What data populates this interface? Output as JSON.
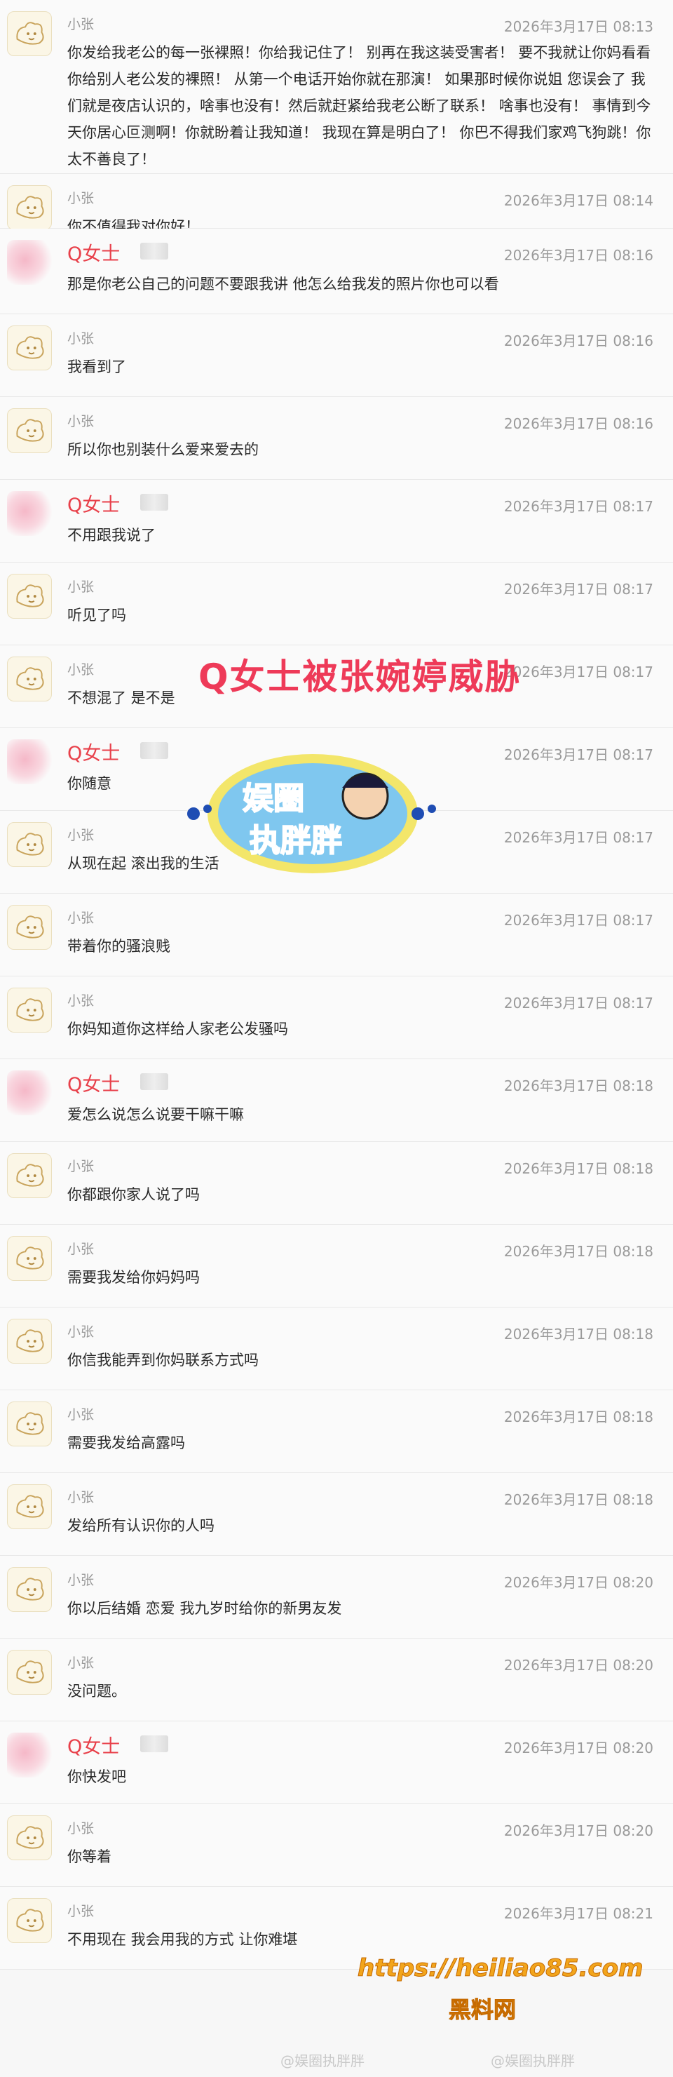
{
  "overlay": {
    "title": "Q女士被张婉婷威胁",
    "logo_line1": "娱圈",
    "logo_line2": "执胖胖",
    "watermark_url": "https://heiliao85.com",
    "watermark_name": "黑料网",
    "faded_left": "@娱圈执胖胖",
    "faded_right": "@娱圈执胖胖"
  },
  "messages": [
    {
      "sender": "小张",
      "time": "2026年3月17日 08:13",
      "text": "你发给我老公的每一张裸照！你给我记住了！ 别再在我这装受害者！ 要不我就让你妈看看你给别人老公发的裸照！ 从第一个电话开始你就在那演！ 如果那时候你说姐 您误会了 我们就是夜店认识的，啥事也没有！然后就赶紧给我老公断了联系！ 啥事也没有！ 事情到今天你居心叵测啊！你就盼着让我知道！ 我现在算是明白了！ 你巴不得我们家鸡飞狗跳！你太不善良了！"
    },
    {
      "sender": "小张",
      "time": "2026年3月17日 08:14",
      "text": "你不值得我对你好！"
    },
    {
      "sender": "Q女士",
      "time": "2026年3月17日 08:16",
      "text": "那是你老公自己的问题不要跟我讲 他怎么给我发的照片你也可以看"
    },
    {
      "sender": "小张",
      "time": "2026年3月17日 08:16",
      "text": "我看到了"
    },
    {
      "sender": "小张",
      "time": "2026年3月17日 08:16",
      "text": "所以你也别装什么爱来爱去的"
    },
    {
      "sender": "Q女士",
      "time": "2026年3月17日 08:17",
      "text": "不用跟我说了"
    },
    {
      "sender": "小张",
      "time": "2026年3月17日 08:17",
      "text": "听见了吗"
    },
    {
      "sender": "小张",
      "time": "2026年3月17日 08:17",
      "text": "不想混了 是不是"
    },
    {
      "sender": "Q女士",
      "time": "2026年3月17日 08:17",
      "text": "你随意"
    },
    {
      "sender": "小张",
      "time": "2026年3月17日 08:17",
      "text": "从现在起 滚出我的生活"
    },
    {
      "sender": "小张",
      "time": "2026年3月17日 08:17",
      "text": "带着你的骚浪贱"
    },
    {
      "sender": "小张",
      "time": "2026年3月17日 08:17",
      "text": "你妈知道你这样给人家老公发骚吗"
    },
    {
      "sender": "Q女士",
      "time": "2026年3月17日 08:18",
      "text": "爱怎么说怎么说要干嘛干嘛"
    },
    {
      "sender": "小张",
      "time": "2026年3月17日 08:18",
      "text": "你都跟你家人说了吗"
    },
    {
      "sender": "小张",
      "time": "2026年3月17日 08:18",
      "text": "需要我发给你妈妈吗"
    },
    {
      "sender": "小张",
      "time": "2026年3月17日 08:18",
      "text": "你信我能弄到你妈联系方式吗"
    },
    {
      "sender": "小张",
      "time": "2026年3月17日 08:18",
      "text": "需要我发给高露吗"
    },
    {
      "sender": "小张",
      "time": "2026年3月17日 08:18",
      "text": "发给所有认识你的人吗"
    },
    {
      "sender": "小张",
      "time": "2026年3月17日 08:20",
      "text": "你以后结婚 恋爱 我九岁时给你的新男友发"
    },
    {
      "sender": "小张",
      "time": "2026年3月17日 08:20",
      "text": "没问题。"
    },
    {
      "sender": "Q女士",
      "time": "2026年3月17日 08:20",
      "text": "你快发吧"
    },
    {
      "sender": "小张",
      "time": "2026年3月17日 08:20",
      "text": "你等着"
    },
    {
      "sender": "小张",
      "time": "2026年3月17日 08:21",
      "text": "不用现在 我会用我的方式 让你难堪"
    }
  ]
}
